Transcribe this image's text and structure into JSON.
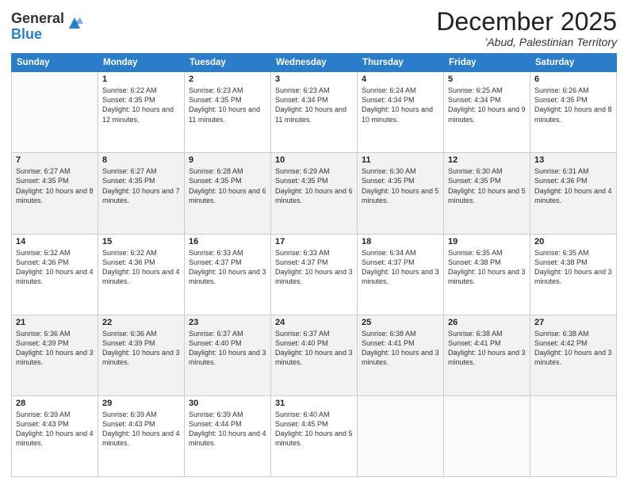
{
  "logo": {
    "general": "General",
    "blue": "Blue"
  },
  "header": {
    "month": "December 2025",
    "location": "'Abud, Palestinian Territory"
  },
  "weekdays": [
    "Sunday",
    "Monday",
    "Tuesday",
    "Wednesday",
    "Thursday",
    "Friday",
    "Saturday"
  ],
  "weeks": [
    [
      {
        "num": "",
        "info": ""
      },
      {
        "num": "1",
        "info": "Sunrise: 6:22 AM\nSunset: 4:35 PM\nDaylight: 10 hours\nand 12 minutes."
      },
      {
        "num": "2",
        "info": "Sunrise: 6:23 AM\nSunset: 4:35 PM\nDaylight: 10 hours\nand 11 minutes."
      },
      {
        "num": "3",
        "info": "Sunrise: 6:23 AM\nSunset: 4:34 PM\nDaylight: 10 hours\nand 11 minutes."
      },
      {
        "num": "4",
        "info": "Sunrise: 6:24 AM\nSunset: 4:34 PM\nDaylight: 10 hours\nand 10 minutes."
      },
      {
        "num": "5",
        "info": "Sunrise: 6:25 AM\nSunset: 4:34 PM\nDaylight: 10 hours\nand 9 minutes."
      },
      {
        "num": "6",
        "info": "Sunrise: 6:26 AM\nSunset: 4:35 PM\nDaylight: 10 hours\nand 8 minutes."
      }
    ],
    [
      {
        "num": "7",
        "info": "Sunrise: 6:27 AM\nSunset: 4:35 PM\nDaylight: 10 hours\nand 8 minutes."
      },
      {
        "num": "8",
        "info": "Sunrise: 6:27 AM\nSunset: 4:35 PM\nDaylight: 10 hours\nand 7 minutes."
      },
      {
        "num": "9",
        "info": "Sunrise: 6:28 AM\nSunset: 4:35 PM\nDaylight: 10 hours\nand 6 minutes."
      },
      {
        "num": "10",
        "info": "Sunrise: 6:29 AM\nSunset: 4:35 PM\nDaylight: 10 hours\nand 6 minutes."
      },
      {
        "num": "11",
        "info": "Sunrise: 6:30 AM\nSunset: 4:35 PM\nDaylight: 10 hours\nand 5 minutes."
      },
      {
        "num": "12",
        "info": "Sunrise: 6:30 AM\nSunset: 4:35 PM\nDaylight: 10 hours\nand 5 minutes."
      },
      {
        "num": "13",
        "info": "Sunrise: 6:31 AM\nSunset: 4:36 PM\nDaylight: 10 hours\nand 4 minutes."
      }
    ],
    [
      {
        "num": "14",
        "info": "Sunrise: 6:32 AM\nSunset: 4:36 PM\nDaylight: 10 hours\nand 4 minutes."
      },
      {
        "num": "15",
        "info": "Sunrise: 6:32 AM\nSunset: 4:36 PM\nDaylight: 10 hours\nand 4 minutes."
      },
      {
        "num": "16",
        "info": "Sunrise: 6:33 AM\nSunset: 4:37 PM\nDaylight: 10 hours\nand 3 minutes."
      },
      {
        "num": "17",
        "info": "Sunrise: 6:33 AM\nSunset: 4:37 PM\nDaylight: 10 hours\nand 3 minutes."
      },
      {
        "num": "18",
        "info": "Sunrise: 6:34 AM\nSunset: 4:37 PM\nDaylight: 10 hours\nand 3 minutes."
      },
      {
        "num": "19",
        "info": "Sunrise: 6:35 AM\nSunset: 4:38 PM\nDaylight: 10 hours\nand 3 minutes."
      },
      {
        "num": "20",
        "info": "Sunrise: 6:35 AM\nSunset: 4:38 PM\nDaylight: 10 hours\nand 3 minutes."
      }
    ],
    [
      {
        "num": "21",
        "info": "Sunrise: 6:36 AM\nSunset: 4:39 PM\nDaylight: 10 hours\nand 3 minutes."
      },
      {
        "num": "22",
        "info": "Sunrise: 6:36 AM\nSunset: 4:39 PM\nDaylight: 10 hours\nand 3 minutes."
      },
      {
        "num": "23",
        "info": "Sunrise: 6:37 AM\nSunset: 4:40 PM\nDaylight: 10 hours\nand 3 minutes."
      },
      {
        "num": "24",
        "info": "Sunrise: 6:37 AM\nSunset: 4:40 PM\nDaylight: 10 hours\nand 3 minutes."
      },
      {
        "num": "25",
        "info": "Sunrise: 6:38 AM\nSunset: 4:41 PM\nDaylight: 10 hours\nand 3 minutes."
      },
      {
        "num": "26",
        "info": "Sunrise: 6:38 AM\nSunset: 4:41 PM\nDaylight: 10 hours\nand 3 minutes."
      },
      {
        "num": "27",
        "info": "Sunrise: 6:38 AM\nSunset: 4:42 PM\nDaylight: 10 hours\nand 3 minutes."
      }
    ],
    [
      {
        "num": "28",
        "info": "Sunrise: 6:39 AM\nSunset: 4:43 PM\nDaylight: 10 hours\nand 4 minutes."
      },
      {
        "num": "29",
        "info": "Sunrise: 6:39 AM\nSunset: 4:43 PM\nDaylight: 10 hours\nand 4 minutes."
      },
      {
        "num": "30",
        "info": "Sunrise: 6:39 AM\nSunset: 4:44 PM\nDaylight: 10 hours\nand 4 minutes."
      },
      {
        "num": "31",
        "info": "Sunrise: 6:40 AM\nSunset: 4:45 PM\nDaylight: 10 hours\nand 5 minutes."
      },
      {
        "num": "",
        "info": ""
      },
      {
        "num": "",
        "info": ""
      },
      {
        "num": "",
        "info": ""
      }
    ]
  ]
}
